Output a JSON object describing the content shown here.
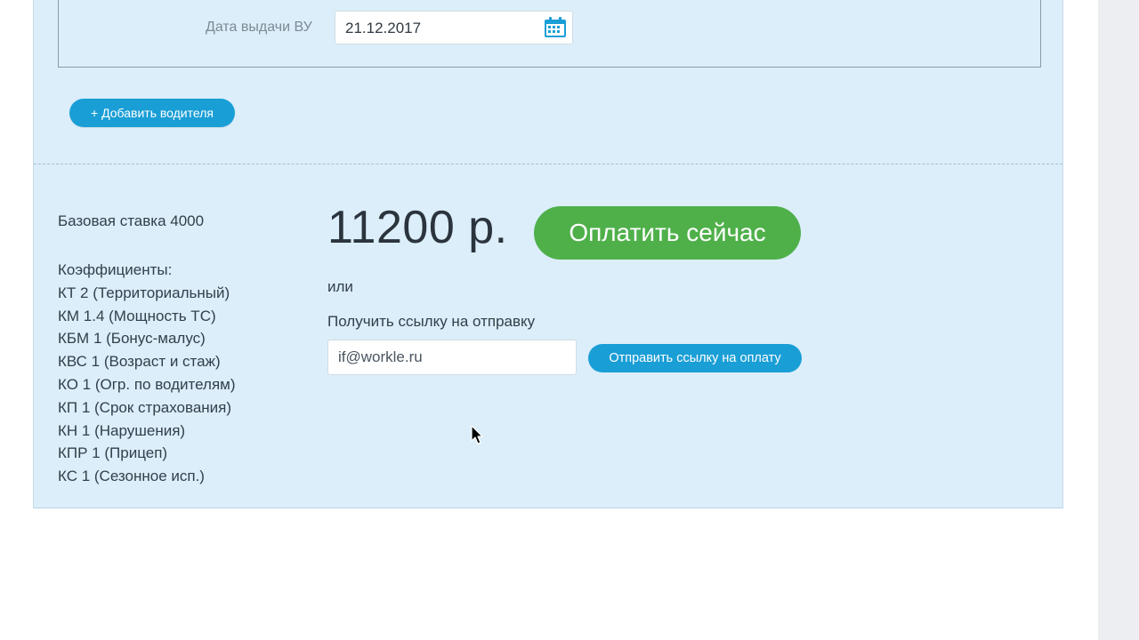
{
  "driver": {
    "license_date_label": "Дата выдачи ВУ",
    "license_date_value": "21.12.2017",
    "calendar_icon": "calendar-icon"
  },
  "add_driver_label": "+ Добавить водителя",
  "summary": {
    "base_rate": "Базовая ставка 4000",
    "coefficients_title": "Коэффициенты:",
    "coefficients": [
      "КТ 2 (Территориальный)",
      "КМ 1.4 (Мощность ТС)",
      "КБМ 1 (Бонус-малус)",
      "КВС 1 (Возраст и стаж)",
      "КО 1 (Огр. по водителям)",
      "КП 1 (Срок страхования)",
      "КН 1 (Нарушения)",
      "КПР 1 (Прицеп)",
      "КС 1 (Сезонное исп.)"
    ]
  },
  "payment": {
    "price": "11200 р.",
    "pay_now_label": "Оплатить сейчас",
    "or_text": "или",
    "link_label": "Получить ссылку на отправку",
    "email_value": "if@workle.ru",
    "send_link_label": "Отправить ссылку на оплату"
  },
  "colors": {
    "panel_bg": "#dbeefa",
    "primary_blue": "#1a9ed6",
    "pay_green": "#4fb04a"
  }
}
